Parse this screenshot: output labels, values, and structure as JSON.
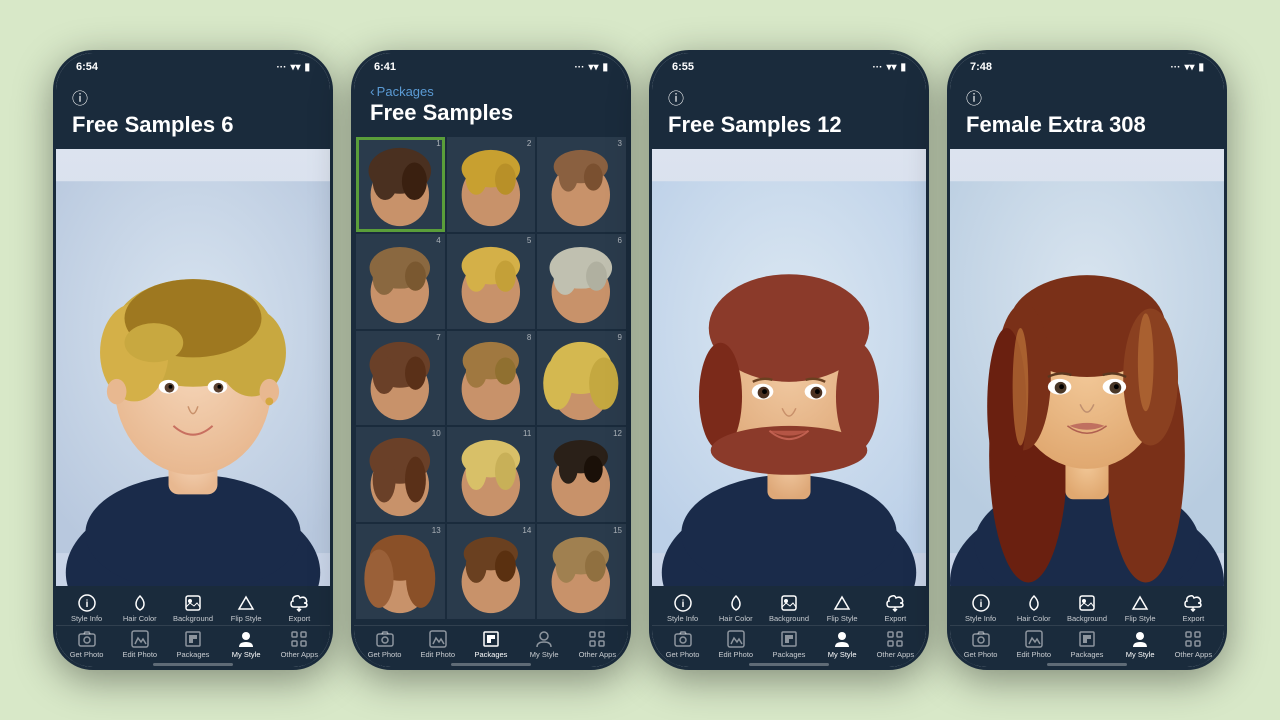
{
  "background_color": "#d8e8c8",
  "phones": [
    {
      "id": "phone1",
      "status_time": "6:54",
      "status_signal": "···",
      "status_wifi": "WiFi",
      "status_battery": "■",
      "has_back": false,
      "title": "Free Samples 6",
      "content_type": "portrait",
      "active_tab_bottom": "My Style",
      "toolbar_top_items": [
        {
          "icon": "ℹ",
          "label": "Style Info",
          "active": false
        },
        {
          "icon": "🪣",
          "label": "Hair Color",
          "active": false
        },
        {
          "icon": "▣",
          "label": "Background",
          "active": false
        },
        {
          "icon": "△",
          "label": "Flip Style",
          "active": false
        },
        {
          "icon": "↪",
          "label": "Export",
          "active": false
        }
      ],
      "toolbar_bottom_items": [
        {
          "icon": "📷",
          "label": "Get Photo",
          "active": false
        },
        {
          "icon": "✎",
          "label": "Edit Photo",
          "active": false
        },
        {
          "icon": "📦",
          "label": "Packages",
          "active": false
        },
        {
          "icon": "👤",
          "label": "My Style",
          "active": true
        },
        {
          "icon": "⋯",
          "label": "Other Apps",
          "active": false
        }
      ]
    },
    {
      "id": "phone2",
      "status_time": "6:41",
      "status_signal": "···",
      "status_wifi": "WiFi",
      "status_battery": "■",
      "has_back": true,
      "back_label": "Packages",
      "title": "Free Samples",
      "content_type": "grid",
      "grid_count": 15,
      "active_tab_bottom": "Packages",
      "toolbar_top_items": [
        {
          "icon": "ℹ",
          "label": "Style Info",
          "active": false
        },
        {
          "icon": "🪣",
          "label": "Hair Color",
          "active": false
        },
        {
          "icon": "▣",
          "label": "Background",
          "active": false
        },
        {
          "icon": "△",
          "label": "Flip Style",
          "active": false
        },
        {
          "icon": "↪",
          "label": "Export",
          "active": false
        }
      ],
      "toolbar_bottom_items": [
        {
          "icon": "📷",
          "label": "Get Photo",
          "active": false
        },
        {
          "icon": "✎",
          "label": "Edit Photo",
          "active": false
        },
        {
          "icon": "📦",
          "label": "Packages",
          "active": true
        },
        {
          "icon": "👤",
          "label": "My Style",
          "active": false
        },
        {
          "icon": "⋯",
          "label": "Other Apps",
          "active": false
        }
      ]
    },
    {
      "id": "phone3",
      "status_time": "6:55",
      "status_signal": "···",
      "status_wifi": "WiFi",
      "status_battery": "■",
      "has_back": false,
      "title": "Free Samples 12",
      "content_type": "portrait",
      "active_tab_bottom": "My Style",
      "toolbar_top_items": [
        {
          "icon": "ℹ",
          "label": "Style Info",
          "active": false
        },
        {
          "icon": "🪣",
          "label": "Hair Color",
          "active": false
        },
        {
          "icon": "▣",
          "label": "Background",
          "active": false
        },
        {
          "icon": "△",
          "label": "Flip Style",
          "active": false
        },
        {
          "icon": "↪",
          "label": "Export",
          "active": false
        }
      ],
      "toolbar_bottom_items": [
        {
          "icon": "📷",
          "label": "Get Photo",
          "active": false
        },
        {
          "icon": "✎",
          "label": "Edit Photo",
          "active": false
        },
        {
          "icon": "📦",
          "label": "Packages",
          "active": false
        },
        {
          "icon": "👤",
          "label": "My Style",
          "active": true
        },
        {
          "icon": "⋯",
          "label": "Other Apps",
          "active": false
        }
      ]
    },
    {
      "id": "phone4",
      "status_time": "7:48",
      "status_signal": "···",
      "status_wifi": "WiFi",
      "status_battery": "■",
      "has_back": false,
      "title": "Female Extra 308",
      "content_type": "portrait",
      "active_tab_bottom": "My Style",
      "toolbar_top_items": [
        {
          "icon": "ℹ",
          "label": "Style Info",
          "active": false
        },
        {
          "icon": "🪣",
          "label": "Hair Color",
          "active": false
        },
        {
          "icon": "▣",
          "label": "Background",
          "active": false
        },
        {
          "icon": "△",
          "label": "Flip Style",
          "active": false
        },
        {
          "icon": "↪",
          "label": "Export",
          "active": false
        }
      ],
      "toolbar_bottom_items": [
        {
          "icon": "📷",
          "label": "Get Photo",
          "active": false
        },
        {
          "icon": "✎",
          "label": "Edit Photo",
          "active": false
        },
        {
          "icon": "📦",
          "label": "Packages",
          "active": false
        },
        {
          "icon": "👤",
          "label": "My Style",
          "active": true
        },
        {
          "icon": "⋯",
          "label": "Other Apps",
          "active": false
        }
      ]
    }
  ],
  "labels": {
    "back_chevron": "‹",
    "info_symbol": "ⓘ"
  }
}
